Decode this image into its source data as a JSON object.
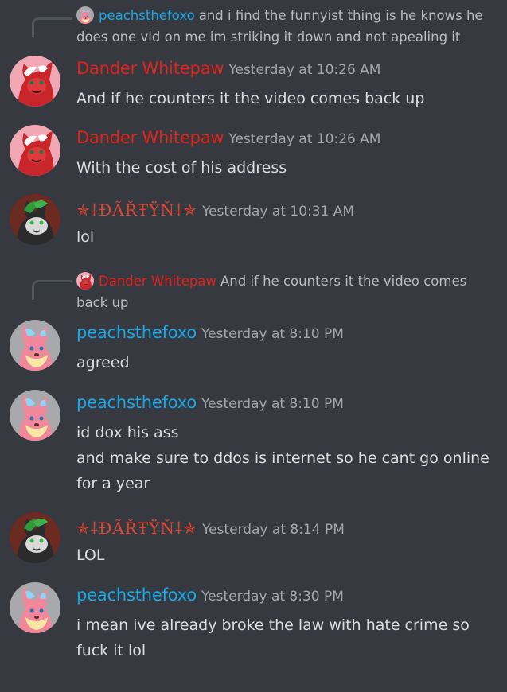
{
  "colors": {
    "background": "#36393f",
    "dander_name": "#e32119",
    "peachs_name": "#19a9e8",
    "dartyn_name": "#e2442e",
    "timestamp": "#a3a6aa",
    "message_text": "#dcddde",
    "reply_text": "#b9bbbe"
  },
  "reply1": {
    "username": "peachsthefoxo",
    "line1": "and i find the funnyist thing is he knows he",
    "line2": "does one vid on me im striking it down and not apealing it"
  },
  "msg1": {
    "username": "Dander Whitepaw",
    "timestamp": "Yesterday at 10:26 AM",
    "lines": [
      "And if he counters it the video comes back up"
    ]
  },
  "msg2": {
    "username": "Dander Whitepaw",
    "timestamp": "Yesterday at 10:26 AM",
    "lines": [
      "With the cost of his address"
    ]
  },
  "msg3": {
    "username": "✯⸸ĐÃŘŦŸŇ⸸✯",
    "timestamp": "Yesterday at 10:31 AM",
    "lines": [
      "lol"
    ]
  },
  "reply2": {
    "username": "Dander Whitepaw",
    "line1": "And if he counters it the video comes",
    "line2": "back up"
  },
  "msg4": {
    "username": "peachsthefoxo",
    "timestamp": "Yesterday at 8:10 PM",
    "lines": [
      "agreed"
    ]
  },
  "msg5": {
    "username": "peachsthefoxo",
    "timestamp": "Yesterday at 8:10 PM",
    "lines": [
      "id dox his ass",
      "and make sure to ddos is internet so he cant go online",
      "for a year"
    ]
  },
  "msg6": {
    "username": "✯⸸ĐÃŘŦŸŇ⸸✯",
    "timestamp": "Yesterday at 8:14 PM",
    "lines": [
      "LOL"
    ]
  },
  "msg7": {
    "username": "peachsthefoxo",
    "timestamp": "Yesterday at 8:30 PM",
    "lines": [
      "i mean ive already broke the law with hate crime so",
      "fuck it lol"
    ]
  }
}
